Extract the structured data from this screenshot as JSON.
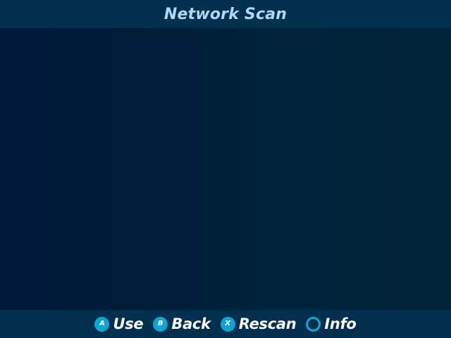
{
  "header": {
    "title": "Network Scan"
  },
  "footer": {
    "hints": [
      {
        "button": "A",
        "label": "Use",
        "icon": "a-button-icon"
      },
      {
        "button": "B",
        "label": "Back",
        "icon": "b-button-icon"
      },
      {
        "button": "X",
        "label": "Rescan",
        "icon": "x-button-icon"
      },
      {
        "button": "",
        "label": "Info",
        "icon": "circle-button-icon"
      }
    ]
  },
  "colors": {
    "accent": "#0ca6d4",
    "title": "#a9dcf2",
    "bar": "#00304e",
    "background": "#001c39"
  }
}
